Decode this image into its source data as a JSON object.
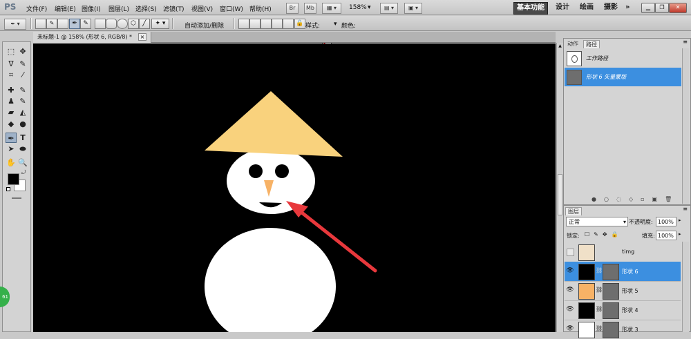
{
  "app": {
    "logo": "PS"
  },
  "menu": [
    "文件(F)",
    "编辑(E)",
    "图像(I)",
    "图层(L)",
    "选择(S)",
    "滤镜(T)",
    "视图(V)",
    "窗口(W)",
    "帮助(H)"
  ],
  "top_controls": {
    "br": "Br",
    "mb": "Mb",
    "zoom": "158%"
  },
  "workspaces": [
    "基本功能",
    "设计",
    "绘画",
    "摄影",
    "»"
  ],
  "options": {
    "auto_add_delete": "自动添加/删除",
    "style_label": "样式:",
    "color_label": "颜色:",
    "color_value": "#000000"
  },
  "document_tab": {
    "title": "未标题-1 @ 158% (形状 6, RGB/8) *",
    "close": "×"
  },
  "paths_panel": {
    "tabs": [
      "动作",
      "路径"
    ],
    "items": [
      {
        "label": "工作路径"
      },
      {
        "label": "形状 6 矢量蒙版"
      }
    ],
    "selected_color": "#3c8fe0"
  },
  "layers_panel": {
    "title": "图层",
    "blend_mode": "正常",
    "opacity_label": "不透明度:",
    "opacity": "100%",
    "lock_label": "锁定:",
    "fill_label": "填充:",
    "fill": "100%",
    "layers": [
      {
        "name": "timg",
        "thumb": "#f0e0c8"
      },
      {
        "name": "形状 6",
        "thumb": "#000000"
      },
      {
        "name": "形状 5",
        "thumb": "#f7b266"
      },
      {
        "name": "形状 4",
        "thumb": "#000000"
      },
      {
        "name": "形状 3",
        "thumb": "#ffffff"
      }
    ]
  },
  "colors": {
    "foreground": "#000000",
    "background": "#ffffff",
    "hat": "#f9d27d",
    "nose": "#f7b266",
    "arrow": "#e8383c"
  },
  "badge": "61"
}
